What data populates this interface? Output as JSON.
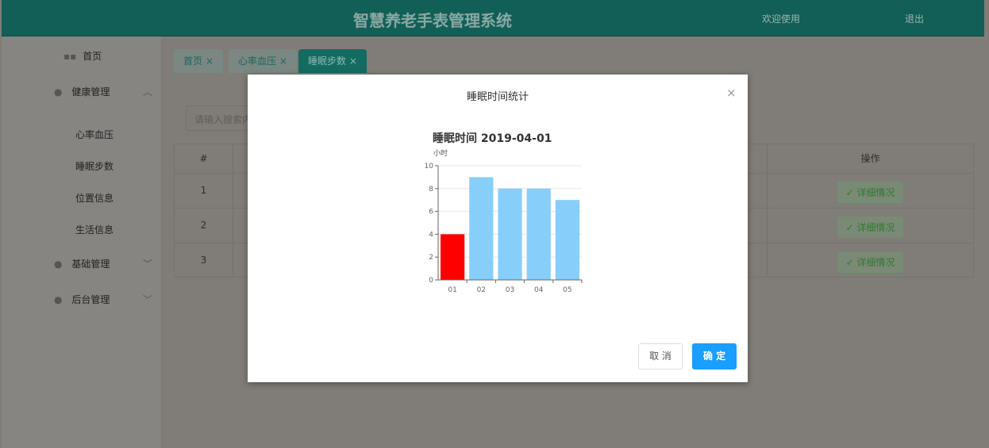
{
  "header": {
    "title": "智慧养老手表管理系统",
    "welcome": "欢迎使用",
    "logout": "退出"
  },
  "sidebar": {
    "home": {
      "label": "首页",
      "icon": "grid-icon"
    },
    "groups": [
      {
        "label": "健康管理",
        "icon": "location-pin-icon",
        "expanded": true,
        "items": [
          "心率血压",
          "睡眠步数",
          "位置信息",
          "生活信息"
        ]
      },
      {
        "label": "基础管理",
        "icon": "location-pin-icon",
        "expanded": false
      },
      {
        "label": "后台管理",
        "icon": "location-pin-icon",
        "expanded": false
      }
    ]
  },
  "tabs": [
    {
      "label": "首页",
      "active": false
    },
    {
      "label": "心率血压",
      "active": false
    },
    {
      "label": "睡眠步数",
      "active": true
    }
  ],
  "search": {
    "placeholder": "请输入搜索内容"
  },
  "table": {
    "headers": {
      "num": "#",
      "op": "操作"
    },
    "rows": [
      {
        "num": "1"
      },
      {
        "num": "2"
      },
      {
        "num": "3"
      }
    ],
    "action_label": "详细情况"
  },
  "modal": {
    "title": "睡眠时间统计",
    "cancel": "取 消",
    "ok": "确 定"
  },
  "chart_data": {
    "type": "bar",
    "title": "睡眠时间  2019-04-01",
    "ylabel": "小时",
    "xlabel": "",
    "categories": [
      "01",
      "02",
      "03",
      "04",
      "05"
    ],
    "values": [
      4,
      9,
      8,
      8,
      7
    ],
    "ylim": [
      0,
      10
    ],
    "yticks": [
      0,
      2,
      4,
      6,
      8,
      10
    ],
    "grid": true,
    "colors": {
      "default": "#87cefa",
      "highlight": "#ff0000"
    },
    "highlight_index": 0
  }
}
